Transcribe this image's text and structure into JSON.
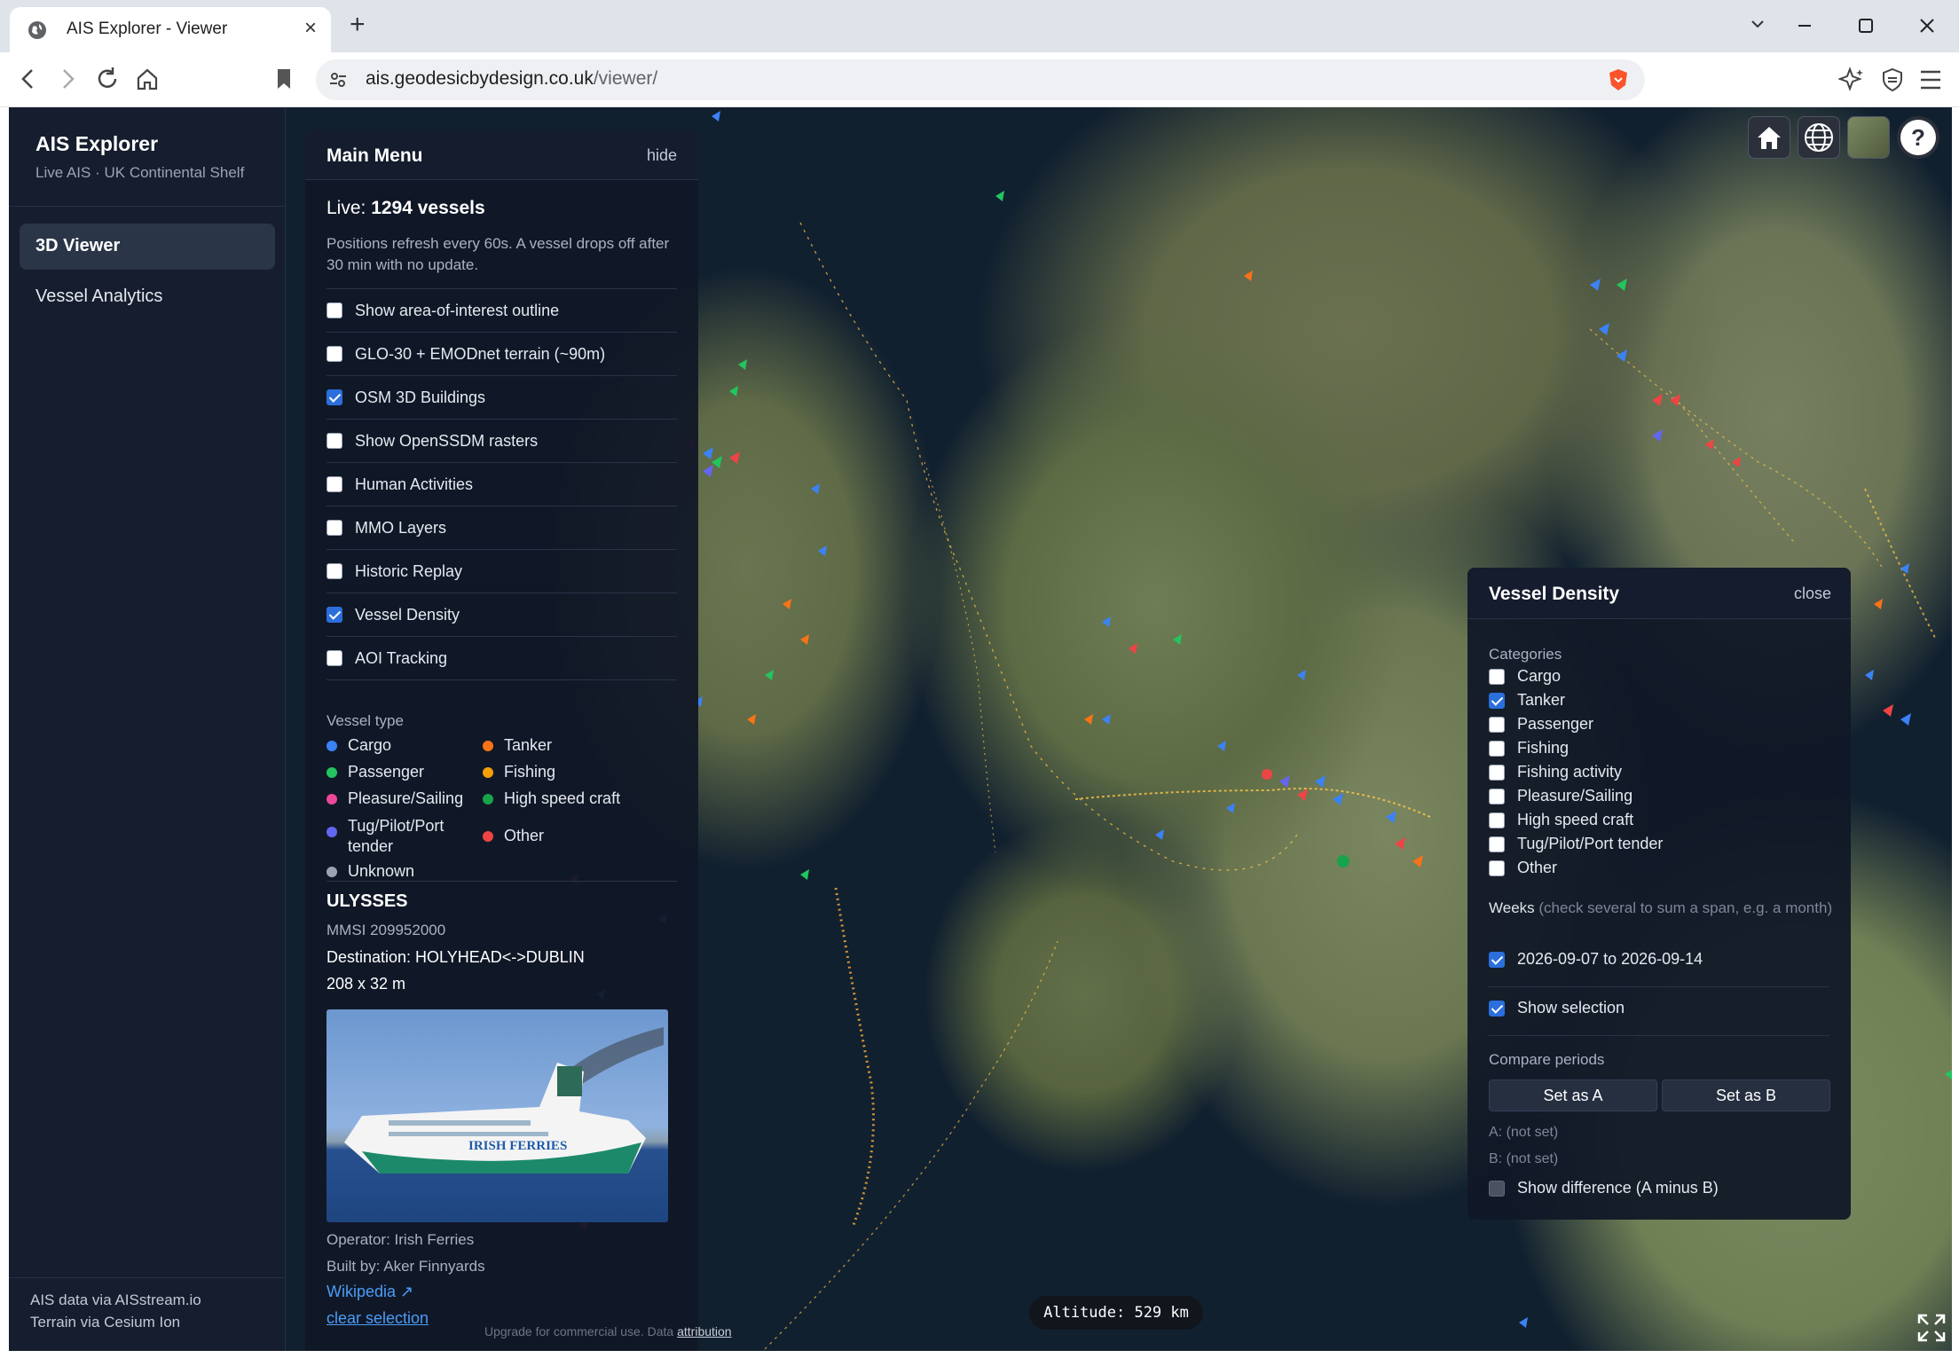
{
  "browser": {
    "tab_title": "AIS Explorer - Viewer",
    "url_host": "ais.geodesicbydesign.co.uk",
    "url_path": "/viewer/"
  },
  "sidebar": {
    "brand": "AIS Explorer",
    "subtitle": "Live AIS · UK Continental Shelf",
    "items": [
      {
        "label": "3D Viewer",
        "active": true
      },
      {
        "label": "Vessel Analytics",
        "active": false
      }
    ],
    "footer_line1": "AIS data via AISstream.io",
    "footer_line2": "Terrain via Cesium Ion"
  },
  "main_menu": {
    "title": "Main Menu",
    "hide_label": "hide",
    "live_prefix": "Live:",
    "live_count": "1294 vessels",
    "refresh_note": "Positions refresh every 60s. A vessel drops off after 30 min with no update.",
    "options": [
      {
        "label": "Show area-of-interest outline",
        "checked": false
      },
      {
        "label": "GLO-30 + EMODnet terrain (~90m)",
        "checked": false
      },
      {
        "label": "OSM 3D Buildings",
        "checked": true
      },
      {
        "label": "Show OpenSSDM rasters",
        "checked": false
      },
      {
        "label": "Human Activities",
        "checked": false
      },
      {
        "label": "MMO Layers",
        "checked": false
      },
      {
        "label": "Historic Replay",
        "checked": false
      },
      {
        "label": "Vessel Density",
        "checked": true
      },
      {
        "label": "AOI Tracking",
        "checked": false
      }
    ],
    "vessel_type_title": "Vessel type",
    "legend": [
      {
        "label": "Cargo",
        "color": "#3b82f6"
      },
      {
        "label": "Tanker",
        "color": "#f97316"
      },
      {
        "label": "Passenger",
        "color": "#22c55e"
      },
      {
        "label": "Fishing",
        "color": "#f59e0b"
      },
      {
        "label": "Pleasure/Sailing",
        "color": "#ec4899"
      },
      {
        "label": "High speed craft",
        "color": "#16a34a"
      },
      {
        "label": "Tug/Pilot/Port tender",
        "color": "#6366f1"
      },
      {
        "label": "Other",
        "color": "#ef4444"
      },
      {
        "label": "Unknown",
        "color": "#9ca3af"
      }
    ]
  },
  "vessel": {
    "name": "ULYSSES",
    "mmsi": "MMSI 209952000",
    "destination": "Destination: HOLYHEAD<->DUBLIN",
    "dimensions": "208 x 32 m",
    "photo_text": "IRISH FERRIES",
    "operator": "Operator: Irish Ferries",
    "builder": "Built by: Aker Finnyards",
    "wikipedia": "Wikipedia ↗",
    "clear": "clear selection"
  },
  "density": {
    "title": "Vessel Density",
    "close_label": "close",
    "categories_title": "Categories",
    "categories": [
      {
        "label": "Cargo",
        "checked": false
      },
      {
        "label": "Tanker",
        "checked": true
      },
      {
        "label": "Passenger",
        "checked": false
      },
      {
        "label": "Fishing",
        "checked": false
      },
      {
        "label": "Fishing activity",
        "checked": false
      },
      {
        "label": "Pleasure/Sailing",
        "checked": false
      },
      {
        "label": "High speed craft",
        "checked": false
      },
      {
        "label": "Tug/Pilot/Port tender",
        "checked": false
      },
      {
        "label": "Other",
        "checked": false
      }
    ],
    "weeks_title": "Weeks",
    "weeks_hint": "(check several to sum a span, e.g. a month)",
    "week": "2026-09-07 to 2026-09-14",
    "show_selection": "Show selection",
    "compare_title": "Compare periods",
    "set_a": "Set as A",
    "set_b": "Set as B",
    "a_status": "A: (not set)",
    "b_status": "B: (not set)",
    "show_difference": "Show difference (A minus B)"
  },
  "map": {
    "altitude": "Altitude: 529 km",
    "attribution_faded": "Upgrade for commercial use.",
    "attribution_data": "Data",
    "attribution_link": "attribution"
  }
}
